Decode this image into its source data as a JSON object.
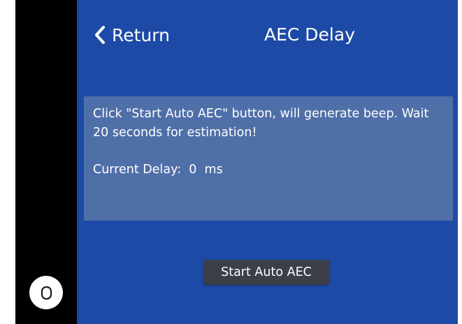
{
  "header": {
    "back_label": "Return",
    "title": "AEC Delay"
  },
  "info": {
    "message": "Click \"Start Auto AEC\" button, will generate beep. Wait 20 seconds for estimation!",
    "delay_label": "Current Delay:",
    "delay_value": "0",
    "delay_unit": "ms"
  },
  "actions": {
    "start_label": "Start Auto AEC"
  },
  "icons": {
    "back": "chevron-left-icon",
    "home": "home-icon"
  },
  "colors": {
    "background": "#1d4aa6",
    "panel": "#4f6fa8",
    "button": "#3b3f48",
    "sidebar": "#000000"
  }
}
